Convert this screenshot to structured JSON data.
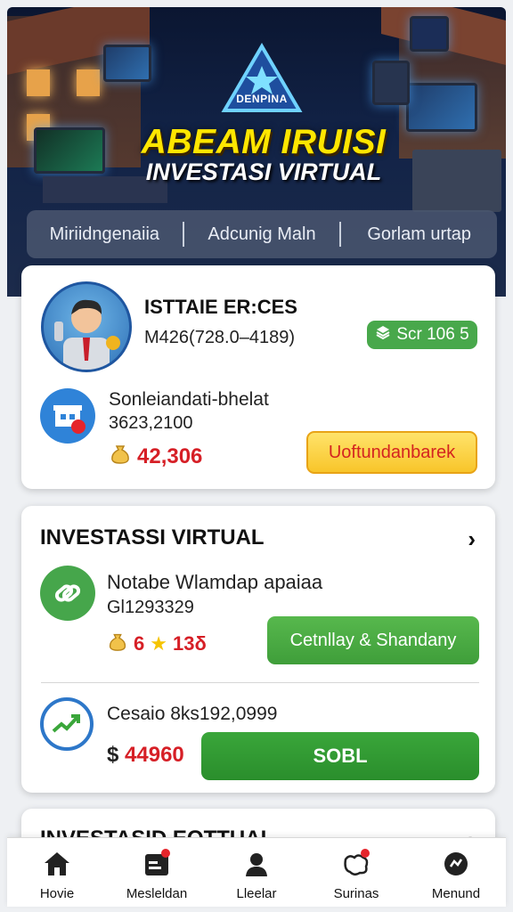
{
  "hero": {
    "logo_text": "DENPINA",
    "title": "ABEAM IRUISI",
    "subtitle": "INVESTASI VIRTUAL",
    "nav": [
      "Miriidngenaiia",
      "Adcunig Maln",
      "Gorlam urtap"
    ]
  },
  "profile_card": {
    "name": "ISTTAIE ER:CES",
    "code": "M426(728.0–4189)",
    "badge": "Scr 106 5",
    "shop_label": "Sonleiandati-bhelat",
    "shop_value": "3623,2100",
    "coins": "42,306",
    "action_button": "Uoftundanbarek"
  },
  "invest_card": {
    "title": "INVESTASSI VIRTUAL",
    "item1": {
      "title": "Notabe Wlamdap apaiaa",
      "code": "Gl1293329",
      "score_prefix": "6",
      "score_suffix": "13δ",
      "button": "Cetnllay & Shandany"
    },
    "item2": {
      "title": "Cesaio 8ks192,0999",
      "currency": "$",
      "price": "44960",
      "button": "SOBL"
    }
  },
  "peek_card": {
    "title": "INVESTASID EOTTUAL"
  },
  "bottom_nav": [
    {
      "label": "Hovie",
      "icon": "home-icon"
    },
    {
      "label": "Mesleldan",
      "icon": "calendar-icon"
    },
    {
      "label": "Lleelar",
      "icon": "user-icon"
    },
    {
      "label": "Surinas",
      "icon": "map-icon"
    },
    {
      "label": "Menund",
      "icon": "menu-icon"
    }
  ],
  "colors": {
    "accent_green": "#46a64b",
    "accent_red": "#d61f26",
    "accent_blue": "#2f83d8",
    "title_yellow": "#ffe600"
  }
}
